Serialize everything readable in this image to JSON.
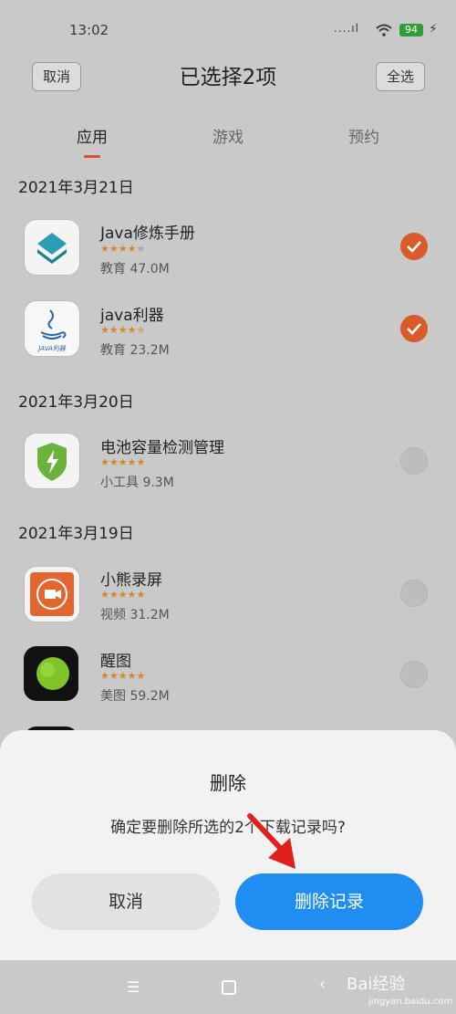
{
  "status": {
    "time": "13:02",
    "signal": "....ıl",
    "battery": "94"
  },
  "header": {
    "cancel": "取消",
    "title": "已选择2项",
    "select_all": "全选"
  },
  "tabs": [
    {
      "label": "应用"
    },
    {
      "label": "游戏"
    },
    {
      "label": "预约"
    }
  ],
  "sections": [
    {
      "date": "2021年3月21日"
    },
    {
      "date": "2021年3月20日"
    },
    {
      "date": "2021年3月19日"
    }
  ],
  "apps": [
    {
      "name": "Java修炼手册",
      "meta": "教育 47.0M",
      "rating": 4,
      "checked": true,
      "icon": "layers-icon"
    },
    {
      "name": "java利器",
      "meta": "教育 23.2M",
      "rating": 4.5,
      "checked": true,
      "icon": "java-icon",
      "icon_caption": "JAVA利器"
    },
    {
      "name": "电池容量检测管理",
      "meta": "小工具 9.3M",
      "rating": 5,
      "checked": false,
      "icon": "battery-shield-icon"
    },
    {
      "name": "小熊录屏",
      "meta": "视频 31.2M",
      "rating": 5,
      "checked": false,
      "icon": "record-icon"
    },
    {
      "name": "醒图",
      "meta": "美图 59.2M",
      "rating": 5,
      "checked": false,
      "icon": "xingtu-icon"
    }
  ],
  "dialog": {
    "title": "删除",
    "message": "确定要删除所选的2个下载记录吗?",
    "cancel": "取消",
    "confirm": "删除记录"
  },
  "watermark": {
    "text": "Bai经验",
    "sub": "jingyan.baidu.com"
  },
  "colors": {
    "accent": "#d95b2a",
    "primary": "#1f8ef0",
    "star": "#d8862c"
  }
}
